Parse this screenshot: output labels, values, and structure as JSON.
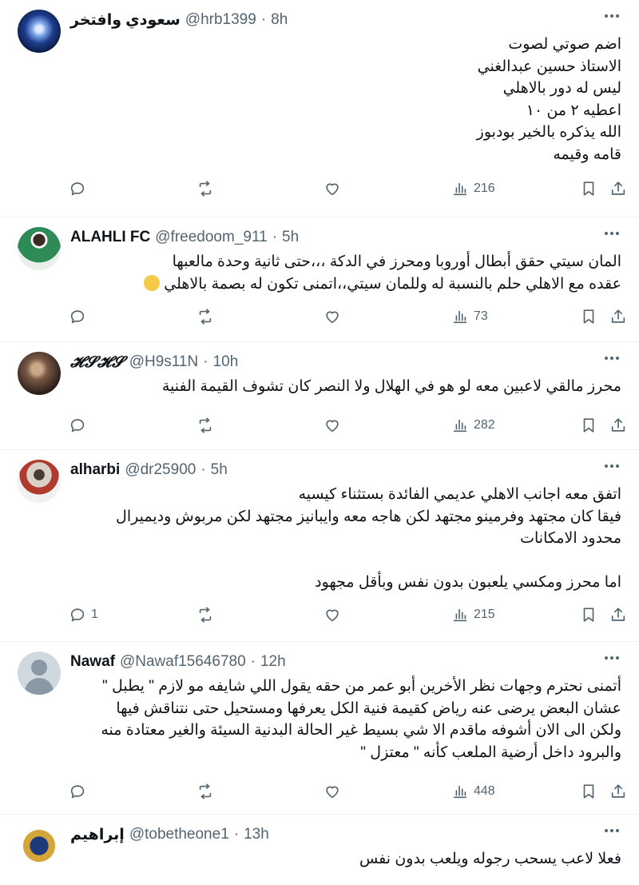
{
  "tweets": [
    {
      "name": "سعودي وافتخر",
      "handle": "@hrb1399",
      "sep": "·",
      "time": "8h",
      "lines": [
        "اضم صوتي لصوت",
        "الاستاذ حسين عبدالغني",
        "ليس له دور بالاهلي",
        "اعطيه ٢ من ١٠",
        "الله يذكره بالخير بودبوز",
        "قامه وقيمه"
      ],
      "replies": "",
      "retweets": "",
      "likes": "",
      "views": "216"
    },
    {
      "name": "ALAHLI FC",
      "handle": "@freedoom_911",
      "sep": "·",
      "time": "5h",
      "lines": [
        "المان سيتي حقق أبطال أوروبا ومحرز في الدكة ،،،حتى ثانية وحدة مالعبها",
        "عقده مع الاهلي حلم بالنسبة له وللمان سيتي،،اتمنى تكون له بصمة بالاهلي"
      ],
      "replies": "",
      "retweets": "",
      "likes": "",
      "views": "73"
    },
    {
      "name": "𝓗𝓢𝓗𝓢",
      "handle": "@H9s11N",
      "sep": "·",
      "time": "10h",
      "lines": [
        "محرز مالقي لاعبين معه لو هو في الهلال ولا النصر كان تشوف القيمة الفنية"
      ],
      "replies": "",
      "retweets": "",
      "likes": "",
      "views": "282"
    },
    {
      "name": "alharbi",
      "handle": "@dr25900",
      "sep": "·",
      "time": "5h",
      "lines": [
        "اتفق معه اجانب الاهلي عديمي الفائدة بستثناء كيسيه",
        "فيقا كان مجتهد وفرمينو مجتهد لكن هاجه معه وايبانيز مجتهد لكن مربوش وديميرال",
        "محدود الامكانات",
        "",
        "اما محرز ومكسي يلعبون بدون نفس وبأقل مجهود"
      ],
      "replies": "1",
      "retweets": "",
      "likes": "",
      "views": "215"
    },
    {
      "name": "Nawaf",
      "handle": "@Nawaf15646780",
      "sep": "·",
      "time": "12h",
      "lines": [
        "أتمنى نحترم وجهات نظر الأخرين أبو عمر من حقه يقول اللي شايفه مو لازم \" يطبل \"",
        "عشان البعض يرضى عنه رياض كقيمة فنية الكل يعرفها ومستحيل حتى نتناقش فيها",
        "ولكن الى الان أشوفه ماقدم الا شي بسيط غير الحالة البدنية السيئة والغير معتادة منه",
        "والبرود داخل أرضية الملعب كأنه \" معتزل \""
      ],
      "replies": "",
      "retweets": "",
      "likes": "",
      "views": "448"
    },
    {
      "name": "إبراهيم",
      "handle": "@tobetheone1",
      "sep": "·",
      "time": "13h",
      "lines": [
        "فعلا لاعب يسحب رجوله ويلعب بدون نفس"
      ]
    }
  ]
}
